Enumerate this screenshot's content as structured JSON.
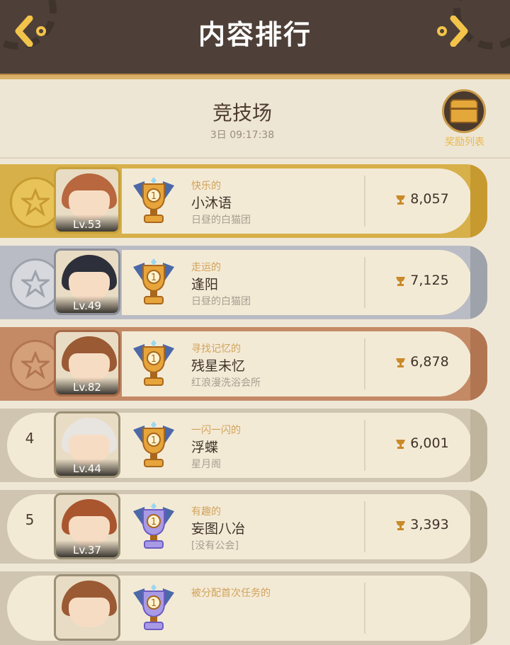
{
  "header": {
    "title": "内容排行"
  },
  "arena": {
    "title": "竞技场",
    "time": "3日 09:17:38",
    "reward_label": "奖励列表"
  },
  "rows": [
    {
      "rank": "1",
      "motto": "快乐的",
      "name": "小沐语",
      "guild": "日昼的白猫团",
      "level": "Lv.53",
      "score": "8,057",
      "tier": "gold"
    },
    {
      "rank": "2",
      "motto": "走运的",
      "name": "逢阳",
      "guild": "日昼的白猫团",
      "level": "Lv.49",
      "score": "7,125",
      "tier": "silver"
    },
    {
      "rank": "3",
      "motto": "寻找记忆的",
      "name": "残星未忆",
      "guild": "红浪漫洗浴会所",
      "level": "Lv.82",
      "score": "6,878",
      "tier": "bronze"
    },
    {
      "rank": "4",
      "motto": "一闪一闪的",
      "name": "浮蝶",
      "guild": "星月阁",
      "level": "Lv.44",
      "score": "6,001",
      "tier": "normal"
    },
    {
      "rank": "5",
      "motto": "有趣的",
      "name": "妄图八冶",
      "guild": "[没有公会]",
      "level": "Lv.37",
      "score": "3,393",
      "tier": "normal"
    },
    {
      "rank": "",
      "motto": "被分配首次任务的",
      "name": "",
      "guild": "",
      "level": "",
      "score": "",
      "tier": "normal"
    }
  ],
  "colors": {
    "header": "#4e4038",
    "gold": "#d7b04a",
    "silver": "#b9bcc4",
    "bronze": "#c48a66",
    "normal": "#cfc5b0"
  },
  "icons": {
    "back": "chevron-left-gear-icon",
    "forward": "chevron-right-gear-icon",
    "trophy": "trophy-icon",
    "chest": "treasure-chest-icon"
  }
}
